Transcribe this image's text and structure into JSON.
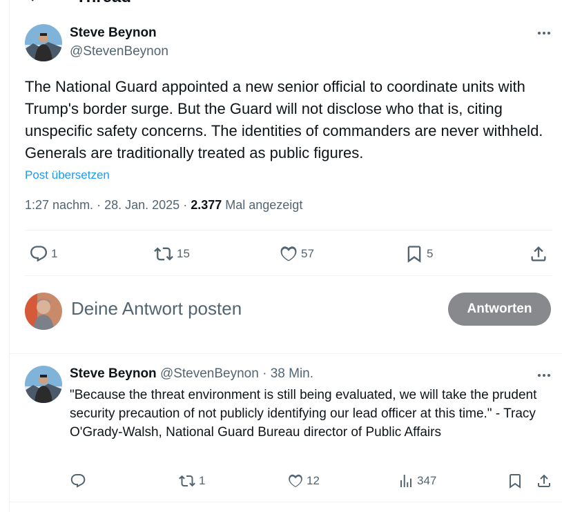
{
  "header": {
    "title": "Thread"
  },
  "post": {
    "author_name": "Steve Beynon",
    "author_handle": "@StevenBeynon",
    "text": "The National Guard appointed a new senior official to coordinate units with Trump's border surge. But the Guard will not disclose who that is, citing unspecific safety concerns. The identities of commanders are never withheld. Generals are traditionally treated as public figures.",
    "translate_label": "Post übersetzen",
    "time": "1:27 nachm.",
    "date": "28. Jan. 2025",
    "views_count": "2.377",
    "views_label": "Mal angezeigt",
    "stats": {
      "replies": "1",
      "reposts": "15",
      "likes": "57",
      "bookmarks": "5"
    }
  },
  "composer": {
    "placeholder": "Deine Antwort posten",
    "button_label": "Antworten"
  },
  "reply": {
    "author_name": "Steve Beynon",
    "author_handle": "@StevenBeynon",
    "age": "38 Min.",
    "text": "\"Because the threat environment is still being evaluated, we will take the prudent security precaution of not publicly identifying our lead officer at this time.\" - Tracy O'Grady-Walsh, National Guard Bureau director of Public Affairs",
    "stats": {
      "replies": "",
      "reposts": "1",
      "likes": "12",
      "views": "347"
    }
  },
  "colors": {
    "accent": "#1d9bf0",
    "muted": "#536471",
    "button_disabled": "#87898c"
  },
  "icons": [
    "back-arrow-icon",
    "more-icon",
    "reply-icon",
    "repost-icon",
    "like-icon",
    "bookmark-icon",
    "share-icon",
    "views-icon"
  ]
}
